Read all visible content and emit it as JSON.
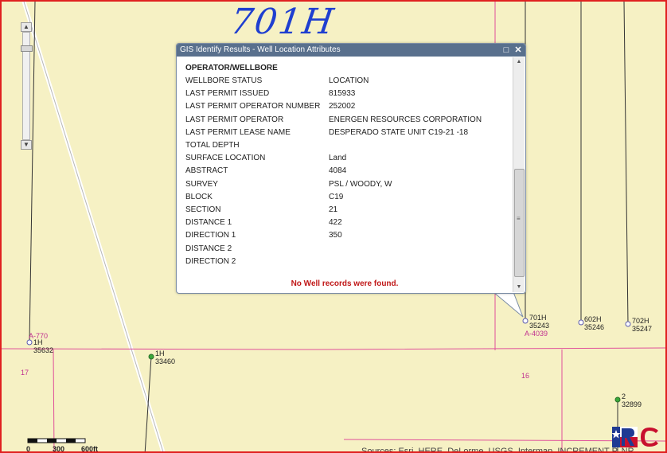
{
  "handwriting": "701H",
  "popup": {
    "title": "GIS Identify Results - Well Location Attributes",
    "heading": "OPERATOR/WELLBORE",
    "attributes": [
      {
        "key": "WELLBORE STATUS",
        "value": "LOCATION"
      },
      {
        "key": "LAST PERMIT ISSUED",
        "value": "815933"
      },
      {
        "key": "LAST PERMIT OPERATOR NUMBER",
        "value": "252002"
      },
      {
        "key": "LAST PERMIT OPERATOR",
        "value": "ENERGEN RESOURCES CORPORATION"
      },
      {
        "key": "LAST PERMIT LEASE NAME",
        "value": "DESPERADO STATE UNIT C19-21 -18"
      },
      {
        "key": "TOTAL DEPTH",
        "value": ""
      },
      {
        "key": "SURFACE LOCATION",
        "value": "Land"
      },
      {
        "key": "ABSTRACT",
        "value": "4084"
      },
      {
        "key": "SURVEY",
        "value": "PSL / WOODY, W"
      },
      {
        "key": "BLOCK",
        "value": "C19"
      },
      {
        "key": "SECTION",
        "value": "21"
      },
      {
        "key": "DISTANCE 1",
        "value": "422"
      },
      {
        "key": "DIRECTION 1",
        "value": "350"
      },
      {
        "key": "DISTANCE 2",
        "value": ""
      },
      {
        "key": "DIRECTION 2",
        "value": ""
      }
    ],
    "message": "No Well records were found."
  },
  "wells": [
    {
      "name": "1H",
      "api": "35632",
      "status": "location"
    },
    {
      "name": "1H",
      "api": "33460",
      "status": "active"
    },
    {
      "name": "701H",
      "api": "35243",
      "status": "location"
    },
    {
      "name": "602H",
      "api": "35246",
      "status": "location"
    },
    {
      "name": "702H",
      "api": "35247",
      "status": "location"
    },
    {
      "name": "2",
      "api": "32899",
      "status": "active"
    }
  ],
  "abstracts": [
    "A-770",
    "A-4039"
  ],
  "sections": [
    "17",
    "16"
  ],
  "scale": {
    "labels": [
      "0",
      "300",
      "600ft"
    ]
  },
  "attribution": "Sources: Esri, HERE, DeLorme, USGS, Intermap, INCREMENT P, NR",
  "colors": {
    "map_background": "#f6f1c4",
    "section_line": "#e0509a",
    "well_location": "#5a5ab0",
    "well_active": "#3aa83a",
    "popup_header": "#59708d",
    "message": "#c01818",
    "frame": "#e02020"
  }
}
